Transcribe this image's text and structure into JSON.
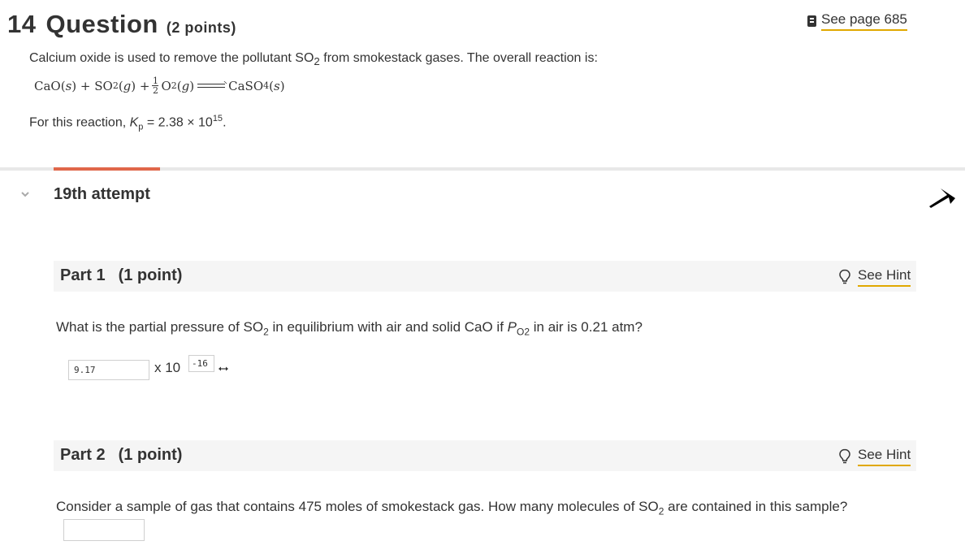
{
  "header": {
    "question_number": "14",
    "question_word": "Question",
    "question_points": "(2 points)",
    "see_page_label": "See page 685"
  },
  "stem": {
    "intro_a": "Calcium oxide is used to remove the pollutant SO",
    "intro_sub": "2",
    "intro_b": " from smokestack gases. The overall reaction is:",
    "eq_cao": "CaO(",
    "eq_s1": "s",
    "eq_close1": ") + SO",
    "eq_so2_sub": "2",
    "eq_g1_open": "(",
    "eq_g1": "g",
    "eq_g1_close": ") + ",
    "eq_frac_num": "1",
    "eq_frac_den": "2",
    "eq_o2": " O",
    "eq_o2_sub": "2",
    "eq_g2_open": "(",
    "eq_g2": "g",
    "eq_g2_close": ")",
    "eq_caso": "CaSO",
    "eq_caso_sub": "4",
    "eq_s2_open": "(",
    "eq_s2": "s",
    "eq_s2_close": ")",
    "kp_a": "For this reaction, ",
    "kp_k": "K",
    "kp_sub": "p",
    "kp_b": " = 2.38 × 10",
    "kp_exp": "15",
    "kp_c": "."
  },
  "attempt": {
    "label": "19th attempt"
  },
  "part1": {
    "title": "Part 1",
    "points": "(1 point)",
    "hint_label": "See Hint",
    "q_a": "What is the partial pressure of SO",
    "q_sub": "2",
    "q_b": " in equilibrium with air and solid CaO if ",
    "q_p": "P",
    "q_psub": "O2",
    "q_c": " in air is 0.21 atm?",
    "mantissa_value": "9.17",
    "times_label": "x 10",
    "exponent_value": "-16"
  },
  "part2": {
    "title": "Part 2",
    "points": "(1 point)",
    "hint_label": "See Hint",
    "q_a": "Consider a sample of gas that contains 475  moles of smokestack gas. How many molecules of SO",
    "q_sub": "2",
    "q_b": " are contained in this sample?",
    "answer_value": ""
  },
  "icons": {
    "book": "book-icon",
    "chevron": "chevron-down-icon",
    "pin": "pin-icon",
    "hint": "lightbulb-icon",
    "resize": "resize-arrows-icon"
  },
  "colors": {
    "accent": "#e0674a",
    "link_underline": "#e0a800",
    "part_bar": "#f5f5f5",
    "text": "#333333"
  }
}
